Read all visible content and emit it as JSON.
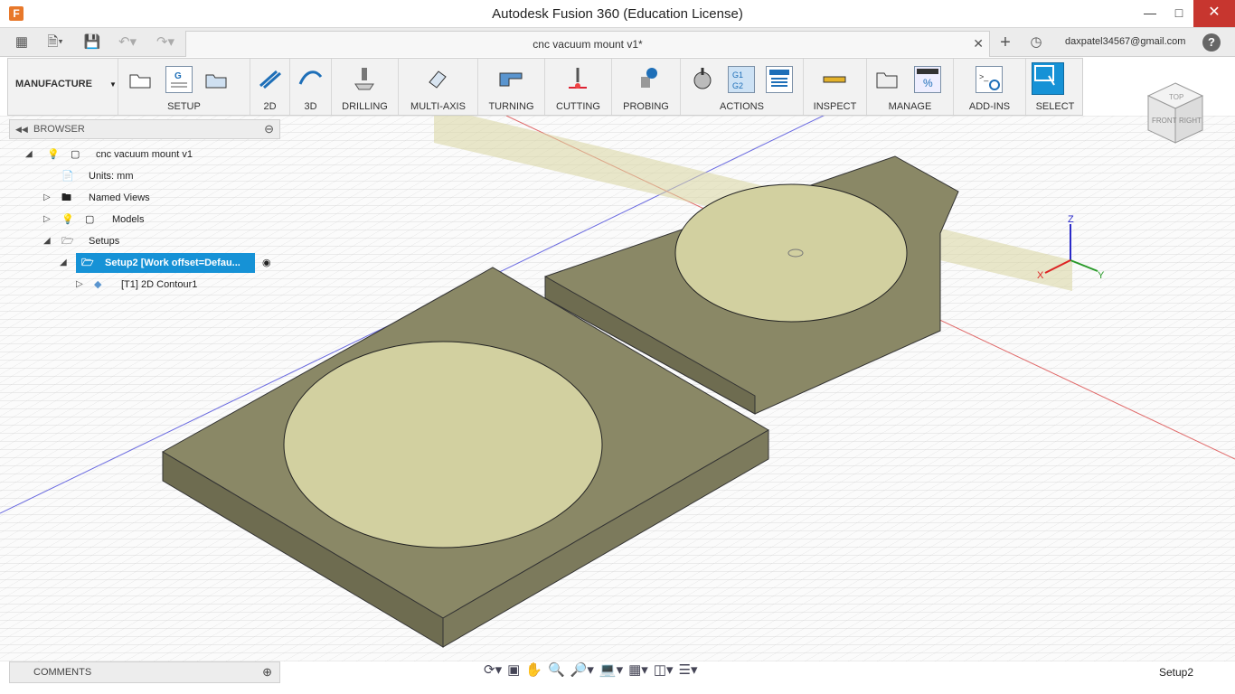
{
  "titlebar": {
    "title": "Autodesk Fusion 360 (Education License)"
  },
  "tabbar": {
    "doc_tab": "cnc vacuum mount v1*",
    "user": "daxpatel34567@gmail.com"
  },
  "ribbon": {
    "workspace": "MANUFACTURE",
    "groups": [
      "SETUP",
      "2D",
      "3D",
      "DRILLING",
      "MULTI-AXIS",
      "TURNING",
      "CUTTING",
      "PROBING",
      "ACTIONS",
      "INSPECT",
      "MANAGE",
      "ADD-INS",
      "SELECT"
    ]
  },
  "browser": {
    "header": "BROWSER",
    "root": "cnc vacuum mount v1",
    "units": "Units: mm",
    "named_views": "Named Views",
    "models": "Models",
    "setups": "Setups",
    "setup2": "Setup2 [Work offset=Defau...",
    "operation": "[T1] 2D Contour1"
  },
  "viewcube": {
    "top": "TOP",
    "front": "FRONT",
    "right": "RIGHT"
  },
  "triad": {
    "x": "X",
    "y": "Y",
    "z": "Z"
  },
  "bottom": {
    "comments": "COMMENTS",
    "setup_name": "Setup2"
  }
}
